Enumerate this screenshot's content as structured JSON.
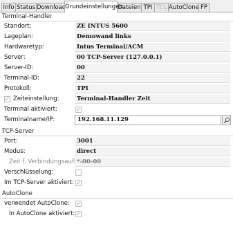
{
  "tabs": [
    {
      "label": "Info",
      "active": false,
      "disabled": false
    },
    {
      "label": "Status",
      "active": false,
      "disabled": false
    },
    {
      "label": "Download",
      "active": false,
      "disabled": false
    },
    {
      "label": "Grundeinstellungen",
      "active": true,
      "disabled": false
    },
    {
      "label": "Dateien",
      "active": false,
      "disabled": false
    },
    {
      "label": "TPI",
      "active": false,
      "disabled": false
    },
    {
      "label": "TCL",
      "active": false,
      "disabled": true
    },
    {
      "label": "AutoClone",
      "active": false,
      "disabled": false
    },
    {
      "label": "FP",
      "active": false,
      "disabled": false
    }
  ],
  "terminal_handler": {
    "header": "Terminal-Handler",
    "standort": {
      "label": "Standort:",
      "value": "ZE INTUS 5600"
    },
    "lageplan": {
      "label": "Lageplan:",
      "value": "Demowand links"
    },
    "hardwaretyp": {
      "label": "Hardwaretyp:",
      "value": "Intus Terminal/ACM"
    },
    "server": {
      "label": "Server:",
      "value": "00 TCP-Server (127.0.0.1)"
    },
    "server_id": {
      "label": "Server-ID:",
      "value": "00"
    },
    "terminal_id": {
      "label": "Terminal-ID:",
      "value": "22"
    },
    "protokoll": {
      "label": "Protokoll:",
      "value": "TPI"
    },
    "zeiteinstellung": {
      "label": "Zeiteinstellung:",
      "value": "Terminal-Handler Zeit",
      "checked": true
    },
    "terminal_aktiviert": {
      "label": "Terminal aktiviert:",
      "checked": true
    },
    "terminalname": {
      "label": "Terminalname/IP:",
      "value": "192.168.11.129"
    }
  },
  "tcp_server": {
    "header": "TCP-Server",
    "port": {
      "label": "Port:",
      "value": "3001"
    },
    "modus": {
      "label": "Modus:",
      "value": "direct"
    },
    "zeit_verbindung": {
      "label": "Zeit f. Verbindungsaufb.:",
      "value": "*-00-00"
    },
    "verschluesselung": {
      "label": "Verschlüsselung:",
      "checked": false
    },
    "im_tcp_server": {
      "label": "Im TCP-Server aktiviert:",
      "checked": true
    }
  },
  "autoclone": {
    "header": "AutoClone",
    "verwendet": {
      "label": "verwendet AutoClone:",
      "checked": true
    },
    "in_autoclone": {
      "label": "In AutoClone aktiviert:",
      "checked": true
    }
  },
  "check_glyph": "✓"
}
